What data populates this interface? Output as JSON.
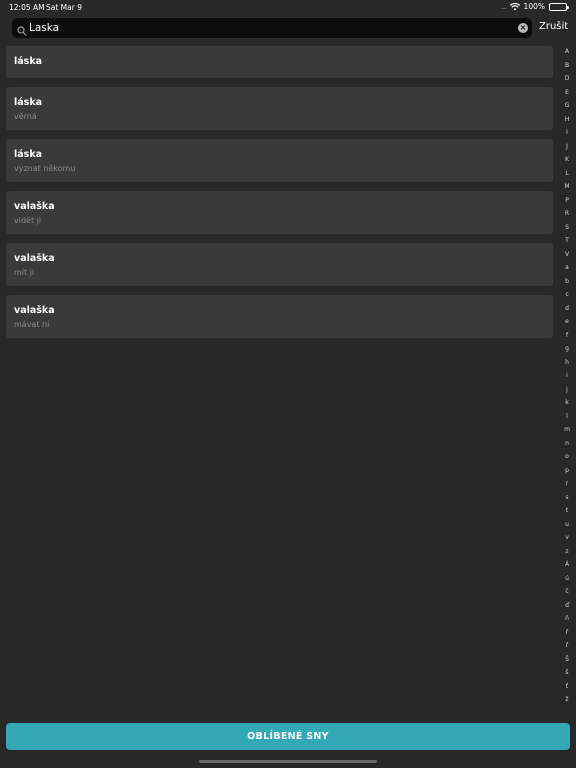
{
  "status": {
    "time": "12:05 AM",
    "date": "Sat Mar 9",
    "signal": "....",
    "battery": "100%"
  },
  "search": {
    "value": "Laska",
    "cancel_label": "Zrušit"
  },
  "results": [
    {
      "word": "láska",
      "sub": ""
    },
    {
      "word": "láska",
      "sub": "věrná"
    },
    {
      "word": "láska",
      "sub": "vyznat někomu"
    },
    {
      "word": "valaška",
      "sub": "vidět ji"
    },
    {
      "word": "valaška",
      "sub": "mít ji"
    },
    {
      "word": "valaška",
      "sub": "mávat ní"
    }
  ],
  "index": [
    "A",
    "B",
    "D",
    "E",
    "G",
    "H",
    "I",
    "J",
    "K",
    "L",
    "M",
    "P",
    "R",
    "S",
    "T",
    "V",
    "a",
    "b",
    "c",
    "d",
    "e",
    "f",
    "g",
    "h",
    "i",
    "j",
    "k",
    "l",
    "m",
    "n",
    "o",
    "p",
    "r",
    "s",
    "t",
    "u",
    "v",
    "z",
    "Á",
    "ú",
    "č",
    "ď",
    "ň",
    "ř",
    "ř",
    "Š",
    "š",
    "ť",
    "ž"
  ],
  "footer": {
    "favorites_label": "OBLÍBENÉ SNY"
  }
}
